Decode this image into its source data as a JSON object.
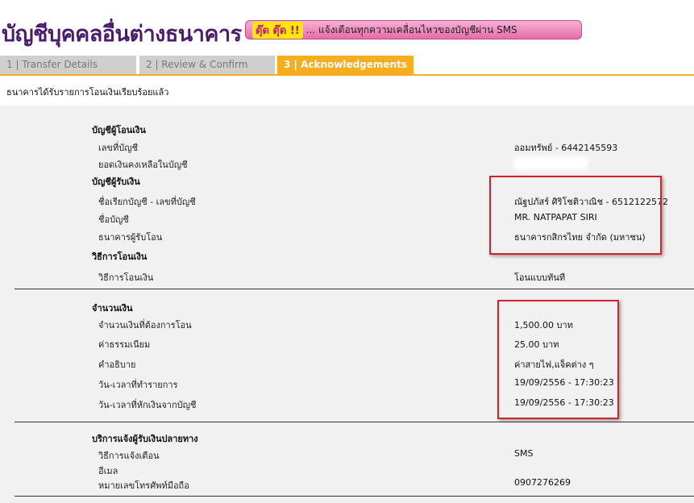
{
  "header": {
    "title": "บัญชีบุคคลอื่นต่างธนาคาร",
    "promo": {
      "highlight": "ตุ๊ด ตุ๊ด !!",
      "text": "... แจ้งเตือนทุกความเคลื่อนไหวของบัญชีผ่าน SMS"
    }
  },
  "tabs": [
    {
      "label": "1 | Transfer Details",
      "active": false
    },
    {
      "label": "2 | Review & Confirm",
      "active": false
    },
    {
      "label": "3 | Acknowledgements",
      "active": true
    }
  ],
  "confirmation_message": "ธนาคารได้รับรายการโอนเงินเรียบร้อยแล้ว",
  "sections": {
    "from_account": {
      "title": "บัญชีผู้โอนเงิน",
      "account_number_label": "เลขที่บัญชี",
      "account_number_value": "ออมทรัพย์ - 6442145593",
      "balance_label": "ยอดเงินคงเหลือในบัญชี"
    },
    "to_account": {
      "title": "บัญชีผู้รับเงิน",
      "nickname_label": "ชื่อเรียกบัญชี - เลขที่บัญชี",
      "nickname_value": "ณัฐปภัสร์ ศิริโชติวาณิช - 6512122572",
      "account_name_label": "ชื่อบัญชี",
      "account_name_value": "MR. NATPAPAT SIRI",
      "bank_label": "ธนาคารผู้รับโอน",
      "bank_value": "ธนาคารกสิกรไทย จำกัด (มหาชน)"
    },
    "transfer_method": {
      "title": "วิธีการโอนเงิน",
      "label": "วิธีการโอนเงิน",
      "value": "โอนแบบทันที"
    },
    "amount": {
      "title": "จำนวนเงิน",
      "amount_label": "จำนวนเงินที่ต้องการโอน",
      "amount_value": "1,500.00 บาท",
      "fee_label": "ค่าธรรมเนียม",
      "fee_value": "25.00 บาท",
      "description_label": "คำอธิบาย",
      "description_value": "ค่าสายไฟ,แจ็คต่าง ๆ",
      "transaction_date_label": "วัน-เวลาที่ทำรายการ",
      "transaction_date_value": "19/09/2556 - 17:30:23",
      "debit_date_label": "วัน-เวลาที่หักเงินจากบัญชี",
      "debit_date_value": "19/09/2556 - 17:30:23"
    },
    "notification": {
      "title": "บริการแจ้งผู้รับเงินปลายทาง",
      "method_label": "วิธีการแจ้งเตือน",
      "method_value": "SMS",
      "email_label": "อีเมล",
      "phone_label": "หมายเลขโทรศัพท์มือถือ",
      "phone_value": "0907276269"
    }
  },
  "colors": {
    "title": "#4b1b6e",
    "active_tab": "#f7ae1e",
    "inactive_tab": "#cfcfcf",
    "panel_background": "#f1f1f1",
    "highlight_box": "#d8202a"
  }
}
